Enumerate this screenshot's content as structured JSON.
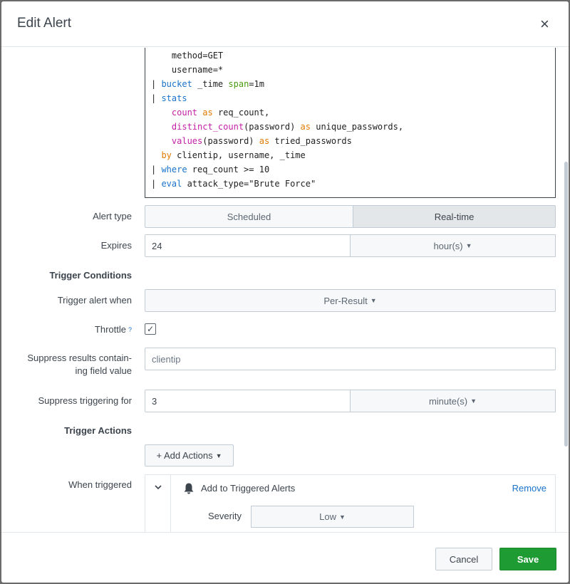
{
  "dialog": {
    "title": "Edit Alert",
    "close_label": "×"
  },
  "search_code": {
    "lines": [
      [
        {
          "t": "    method=GET"
        }
      ],
      [
        {
          "t": "    username=*"
        }
      ],
      [
        {
          "t": "| "
        },
        {
          "t": "bucket",
          "c": "kw-blue"
        },
        {
          "t": " _time "
        },
        {
          "t": "span",
          "c": "kw-green"
        },
        {
          "t": "=1m"
        }
      ],
      [
        {
          "t": "| "
        },
        {
          "t": "stats",
          "c": "kw-blue"
        }
      ],
      [
        {
          "t": "    "
        },
        {
          "t": "count",
          "c": "kw-pink"
        },
        {
          "t": " "
        },
        {
          "t": "as",
          "c": "kw-orange"
        },
        {
          "t": " req_count,"
        }
      ],
      [
        {
          "t": "    "
        },
        {
          "t": "distinct_count",
          "c": "kw-pink"
        },
        {
          "t": "(password) "
        },
        {
          "t": "as",
          "c": "kw-orange"
        },
        {
          "t": " unique_passwords,"
        }
      ],
      [
        {
          "t": "    "
        },
        {
          "t": "values",
          "c": "kw-pink"
        },
        {
          "t": "(password) "
        },
        {
          "t": "as",
          "c": "kw-orange"
        },
        {
          "t": " tried_passwords"
        }
      ],
      [
        {
          "t": "  "
        },
        {
          "t": "by",
          "c": "kw-orange"
        },
        {
          "t": " clientip, username, _time"
        }
      ],
      [
        {
          "t": "| "
        },
        {
          "t": "where",
          "c": "kw-blue"
        },
        {
          "t": " req_count >= 10"
        }
      ],
      [
        {
          "t": "| "
        },
        {
          "t": "eval",
          "c": "kw-blue"
        },
        {
          "t": " attack_type=\"Brute Force\""
        }
      ]
    ]
  },
  "alert_type": {
    "label": "Alert type",
    "options": [
      "Scheduled",
      "Real-time"
    ],
    "selected": "Real-time"
  },
  "expires": {
    "label": "Expires",
    "value": "24",
    "unit": "hour(s)"
  },
  "trigger_conditions": {
    "heading": "Trigger Conditions"
  },
  "trigger_when": {
    "label": "Trigger alert when",
    "value": "Per-Result"
  },
  "throttle": {
    "label": "Throttle",
    "help": "?",
    "checked_glyph": "✓"
  },
  "suppress_field": {
    "label_line1": "Suppress results contain-",
    "label_line2": "ing field value",
    "value": "clientip"
  },
  "suppress_for": {
    "label": "Suppress triggering for",
    "value": "3",
    "unit": "minute(s)"
  },
  "trigger_actions": {
    "heading": "Trigger Actions",
    "add_label": "+ Add Actions"
  },
  "when_triggered": {
    "label": "When triggered",
    "action_title": "Add to Triggered Alerts",
    "remove_label": "Remove",
    "severity_label": "Severity",
    "severity_value": "Low"
  },
  "footer": {
    "cancel_label": "Cancel",
    "save_label": "Save"
  },
  "colors": {
    "save": "#1e9b33",
    "link": "#1a73c9",
    "keyword_blue": "#1a73c9",
    "keyword_pink": "#c21ea5",
    "keyword_orange": "#e07b00"
  }
}
